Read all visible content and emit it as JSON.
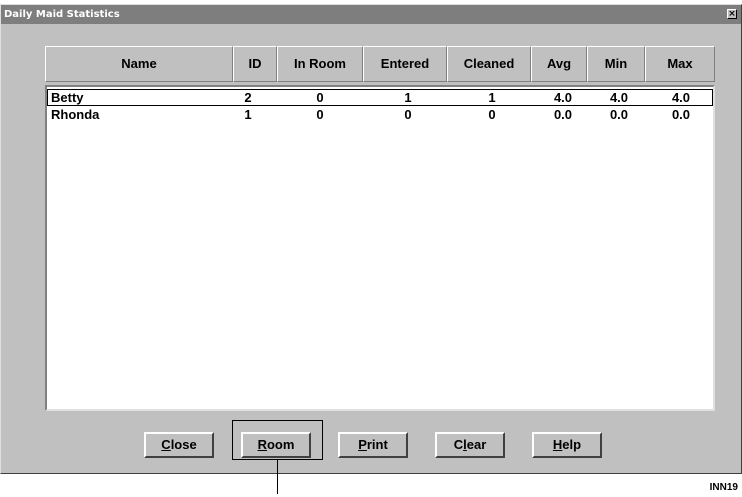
{
  "window": {
    "title": "Daily Maid Statistics",
    "close_glyph": "×"
  },
  "columns": [
    "Name",
    "ID",
    "In Room",
    "Entered",
    "Cleaned",
    "Avg",
    "Min",
    "Max"
  ],
  "rows": [
    {
      "name": "Betty",
      "id": "2",
      "in_room": "0",
      "entered": "1",
      "cleaned": "1",
      "avg": "4.0",
      "min": "4.0",
      "max": "4.0",
      "selected": true
    },
    {
      "name": "Rhonda",
      "id": "1",
      "in_room": "0",
      "entered": "0",
      "cleaned": "0",
      "avg": "0.0",
      "min": "0.0",
      "max": "0.0",
      "selected": false
    }
  ],
  "buttons": {
    "close": {
      "hot": "C",
      "rest": "lose"
    },
    "room": {
      "hot": "R",
      "rest": "oom"
    },
    "print": {
      "hot": "P",
      "rest": "rint"
    },
    "clear": {
      "hot": "",
      "pre": "C",
      "hot2": "l",
      "rest": "ear"
    },
    "help": {
      "hot": "H",
      "rest": "elp"
    }
  },
  "figure_label": "INN19",
  "colors": {
    "dialog_bg": "#c0c0c0",
    "titlebar_bg": "#7e7e7e",
    "list_bg": "#ffffff"
  }
}
